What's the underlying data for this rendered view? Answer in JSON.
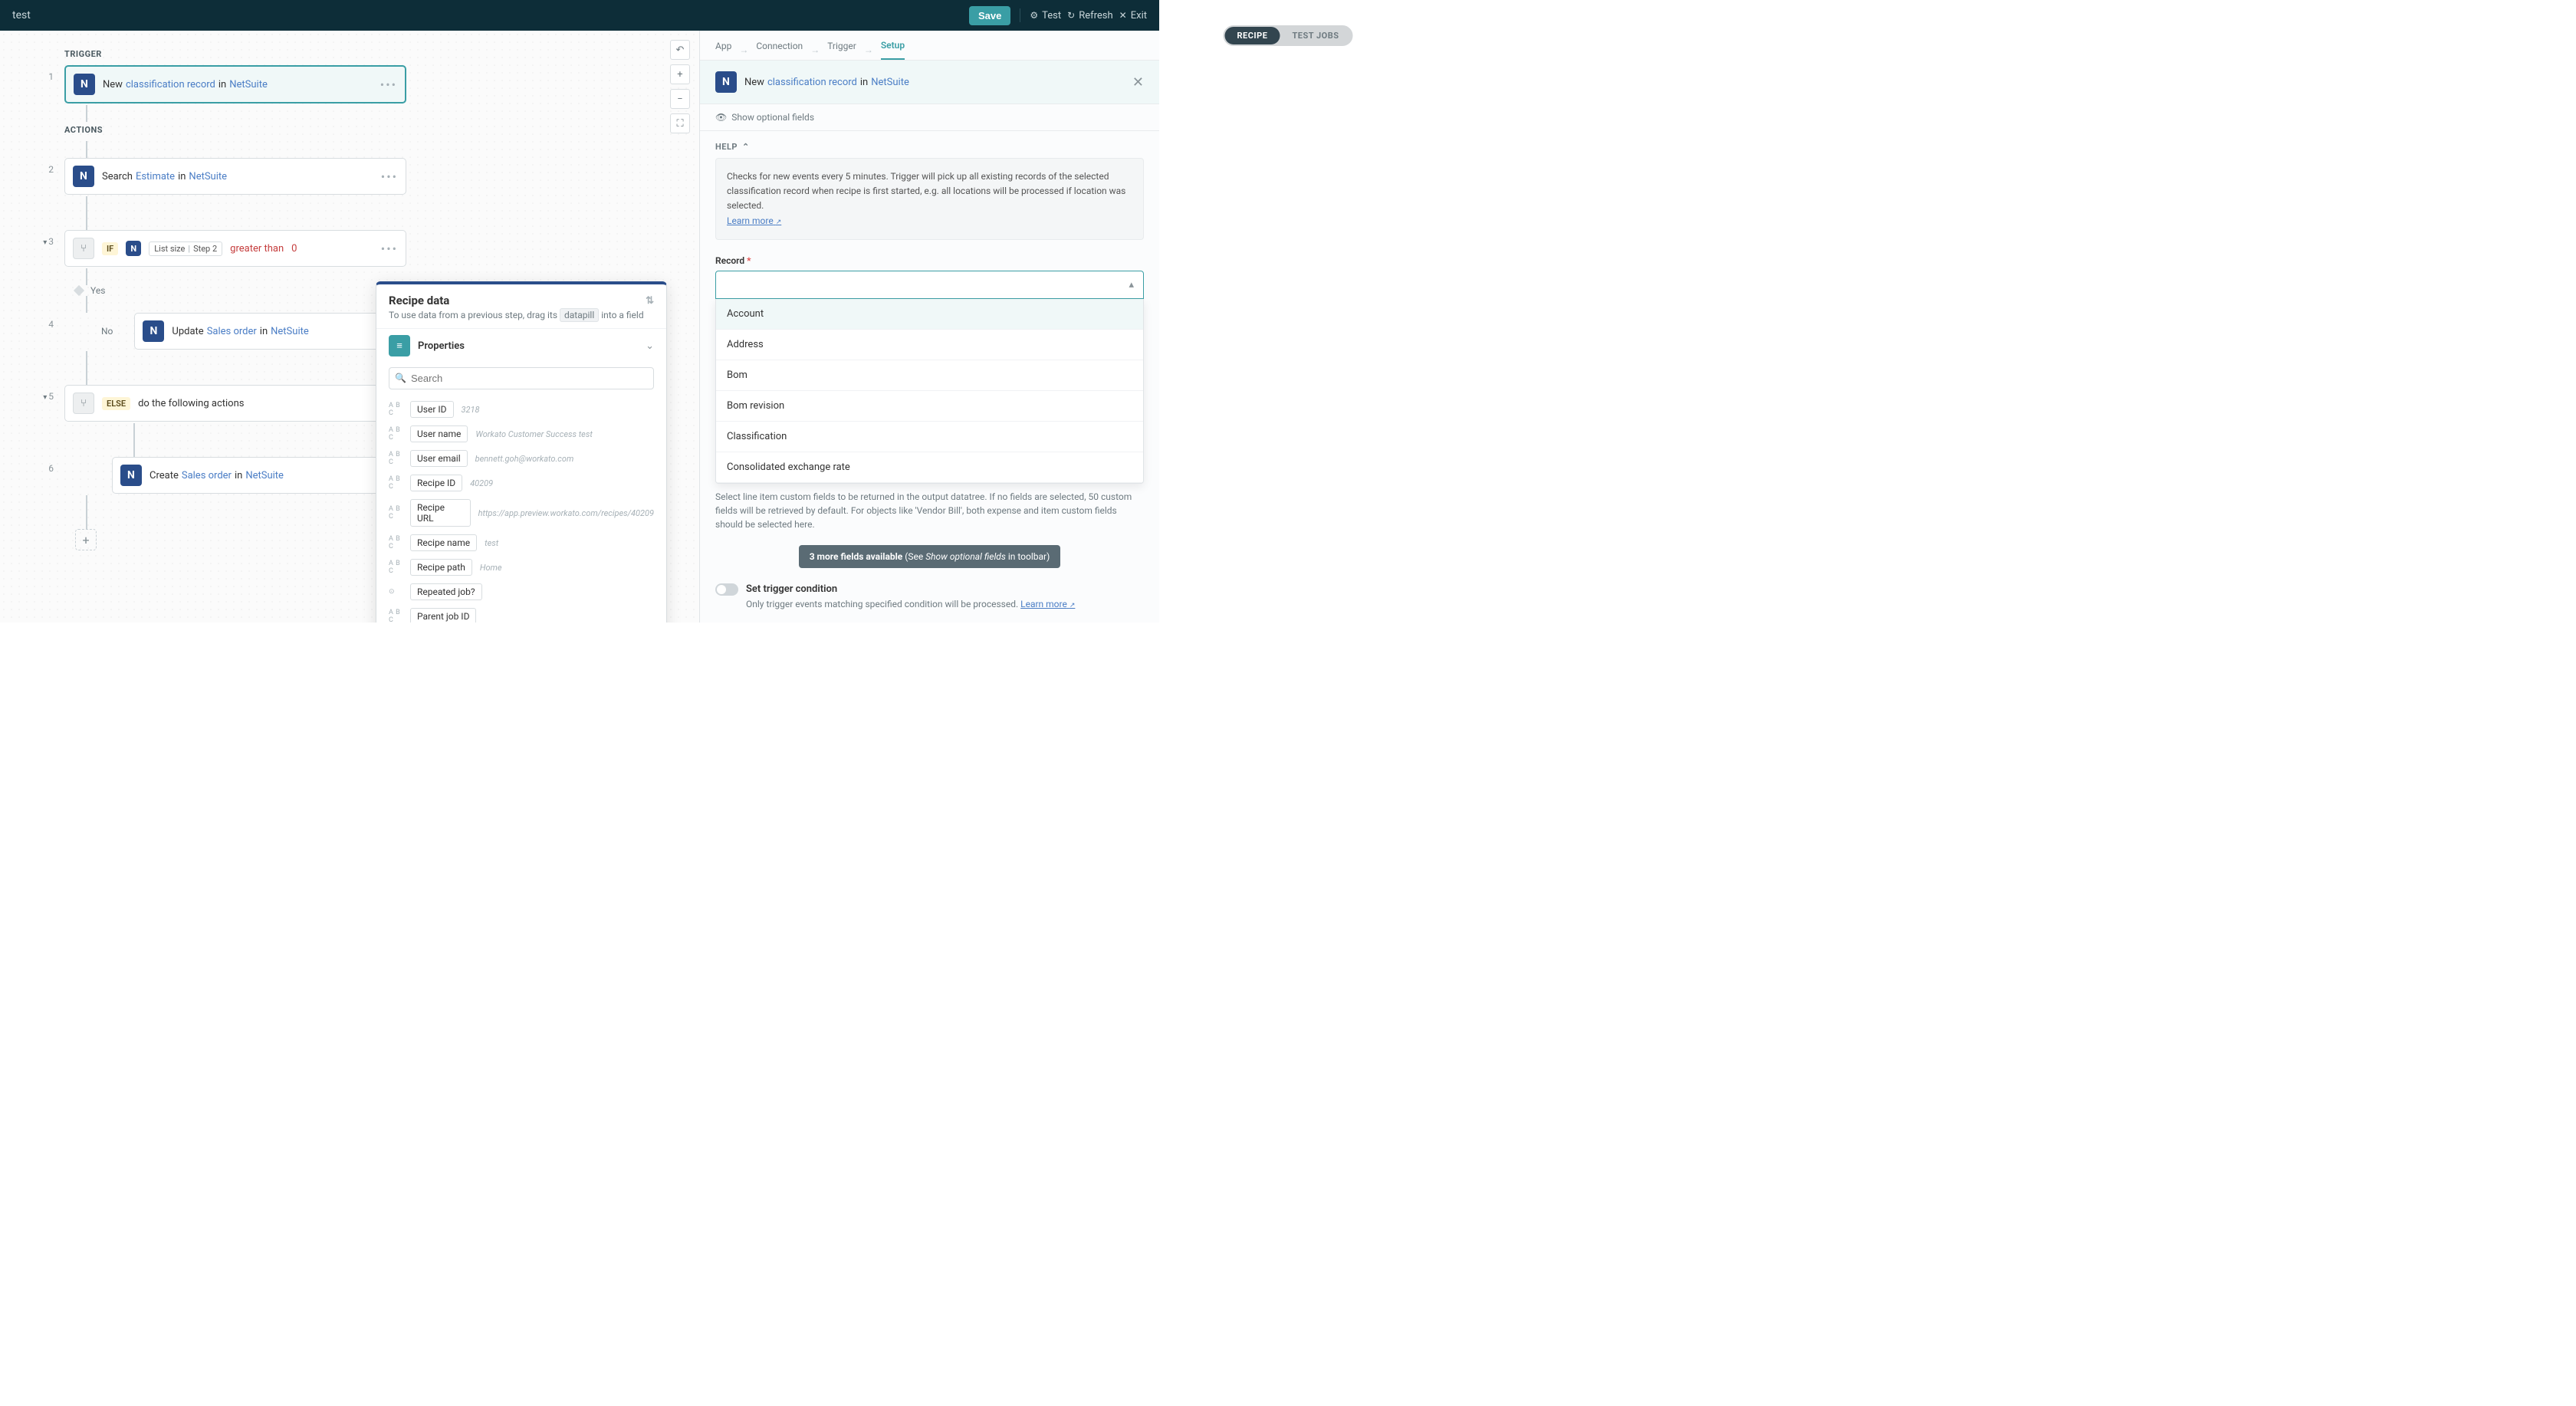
{
  "topbar": {
    "title": "test",
    "save": "Save",
    "test": "Test",
    "refresh": "Refresh",
    "exit": "Exit"
  },
  "pill_tabs": {
    "recipe": "RECIPE",
    "test_jobs": "TEST JOBS"
  },
  "sections": {
    "trigger": "TRIGGER",
    "actions": "ACTIONS"
  },
  "steps": {
    "s1": {
      "num": "1",
      "pre": "New ",
      "obj": "classification record",
      "mid": " in ",
      "app": "NetSuite"
    },
    "s2": {
      "num": "2",
      "pre": "Search ",
      "obj": "Estimate",
      "mid": " in ",
      "app": "NetSuite"
    },
    "s3": {
      "num": "3",
      "if": "IF",
      "chip1": "List size",
      "chip2": "Step 2",
      "op": "greater than",
      "val": "0"
    },
    "yes": "Yes",
    "s4": {
      "num": "4",
      "no": "No",
      "pre": "Update ",
      "obj": "Sales order",
      "mid": " in ",
      "app": "NetSuite"
    },
    "s5": {
      "num": "5",
      "else": "ELSE",
      "txt": "do the following actions"
    },
    "s6": {
      "num": "6",
      "pre": "Create ",
      "obj": "Sales order",
      "mid": " in ",
      "app": "NetSuite"
    }
  },
  "popover": {
    "title": "Recipe data",
    "sub_pre": "To use data from a previous step, drag its ",
    "sub_pill": "datapill",
    "sub_post": " into a field",
    "section": "Properties",
    "search_placeholder": "Search",
    "items": [
      {
        "type": "A B C",
        "name": "User ID",
        "val": "3218"
      },
      {
        "type": "A B C",
        "name": "User name",
        "val": "Workato Customer Success test"
      },
      {
        "type": "A B C",
        "name": "User email",
        "val": "bennett.goh@workato.com"
      },
      {
        "type": "A B C",
        "name": "Recipe ID",
        "val": "40209"
      },
      {
        "type": "A B C",
        "name": "Recipe URL",
        "val": "https://app.preview.workato.com/recipes/40209"
      },
      {
        "type": "A B C",
        "name": "Recipe name",
        "val": "test"
      },
      {
        "type": "A B C",
        "name": "Recipe path",
        "val": "Home"
      },
      {
        "type": "⊙",
        "name": "Repeated job?",
        "val": ""
      },
      {
        "type": "A B C",
        "name": "Parent job ID",
        "val": ""
      }
    ]
  },
  "right": {
    "tabs": {
      "app": "App",
      "connection": "Connection",
      "trigger": "Trigger",
      "setup": "Setup"
    },
    "header": {
      "pre": "New ",
      "obj": "classification record",
      "mid": " in ",
      "app": "NetSuite"
    },
    "show_optional": "Show optional fields",
    "help_label": "HELP",
    "help_text": "Checks for new events every 5 minutes. Trigger will pick up all existing records of the selected classification record when recipe is first started, e.g. all locations will be processed if location was selected.",
    "learn_more": "Learn more",
    "record_label": "Record",
    "dropdown": [
      "Account",
      "Address",
      "Bom",
      "Bom revision",
      "Classification",
      "Consolidated exchange rate"
    ],
    "hint": "Select line item custom fields to be returned in the output datatree. If no fields are selected, 50 custom fields will be retrieved by default. For objects like 'Vendor Bill', both expense and item custom fields should be selected here.",
    "more_fields": {
      "pre": "3 more fields available",
      "mid": " (See ",
      "em": "Show optional fields",
      "post": " in toolbar)"
    },
    "toggle": {
      "label": "Set trigger condition",
      "sub": "Only trigger events matching specified condition will be processed. ",
      "link": "Learn more"
    }
  }
}
